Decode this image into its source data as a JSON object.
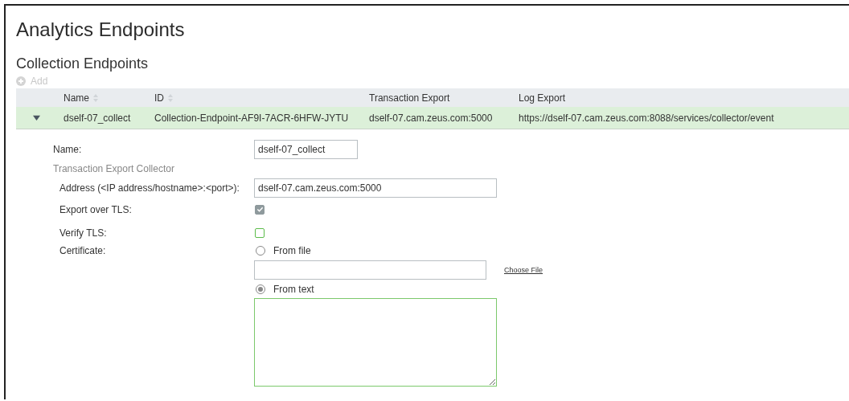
{
  "page": {
    "title": "Analytics Endpoints"
  },
  "section": {
    "title": "Collection Endpoints",
    "add_label": "Add"
  },
  "table": {
    "columns": [
      {
        "label": "Name",
        "sortable": true
      },
      {
        "label": "ID",
        "sortable": true
      },
      {
        "label": "Transaction Export",
        "sortable": false
      },
      {
        "label": "Log Export",
        "sortable": false
      }
    ],
    "rows": [
      {
        "expanded": true,
        "selected": true,
        "cells": [
          "dself-07_collect",
          "Collection-Endpoint-AF9I-7ACR-6HFW-JYTU",
          "dself-07.cam.zeus.com:5000",
          "https://dself-07.cam.zeus.com:8088/services/collector/event"
        ]
      }
    ]
  },
  "form": {
    "name_label": "Name:",
    "name_value": "dself-07_collect",
    "group_title": "Transaction Export Collector",
    "address_label": "Address (<IP address/hostname>:<port>):",
    "address_value": "dself-07.cam.zeus.com:5000",
    "checkboxes": [
      {
        "label": "Export over TLS:",
        "checked": true,
        "disabled": true
      },
      {
        "label": "Verify TLS:",
        "checked": false,
        "disabled": false
      }
    ],
    "certificate_label": "Certificate:",
    "radios": [
      {
        "label": "From file",
        "selected": false
      },
      {
        "label": "From text",
        "selected": true
      }
    ],
    "choose_file_label": "Choose File"
  }
}
